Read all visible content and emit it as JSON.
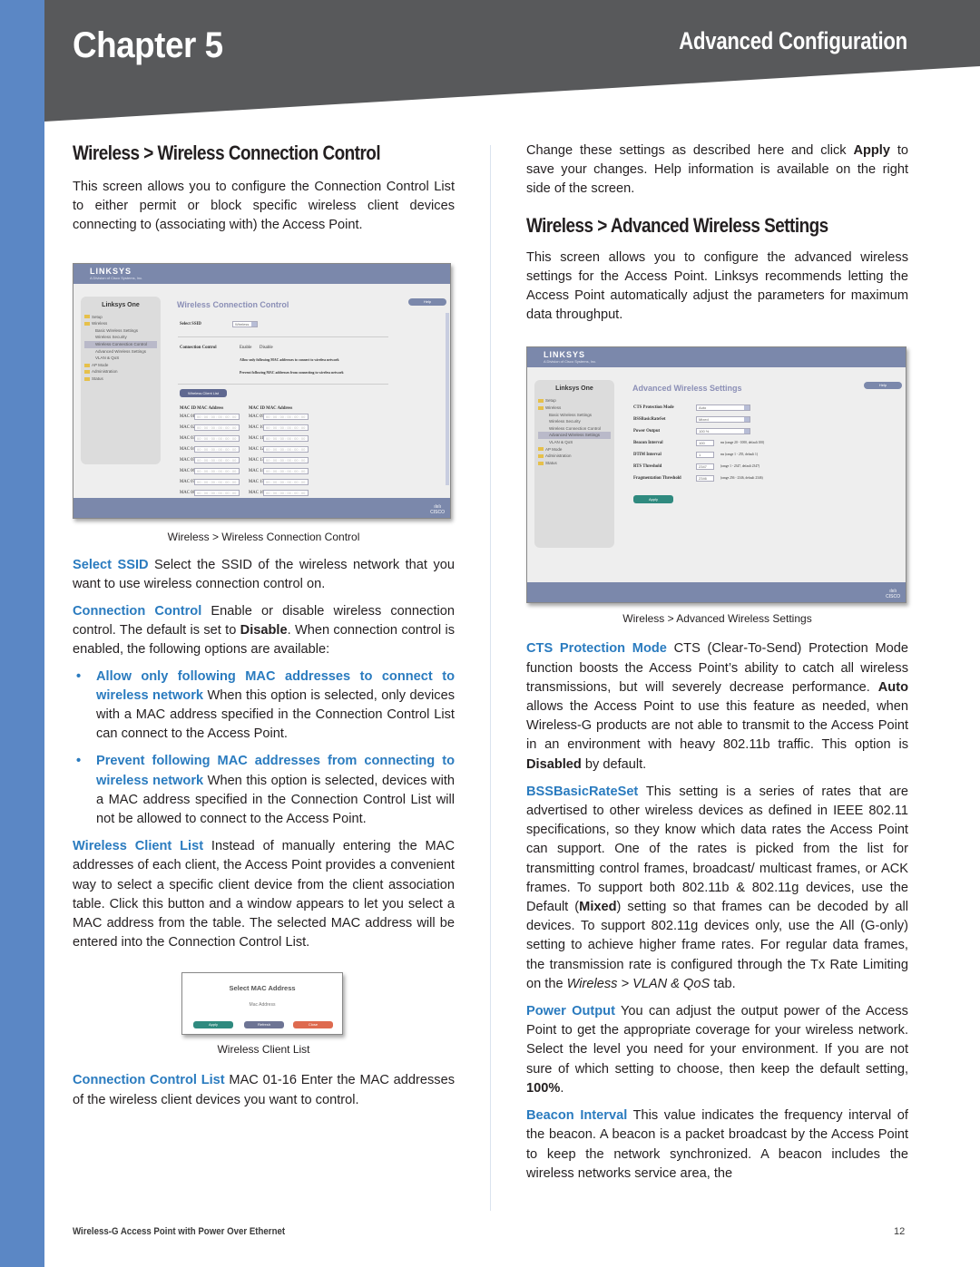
{
  "colors": {
    "side_bar": "#5b87c5",
    "header_band": "#58595b",
    "term_blue": "#2a7bbf",
    "body_text": "#231f20"
  },
  "header": {
    "chapter": "Chapter 5",
    "section": "Advanced Configuration"
  },
  "left": {
    "heading": "Wireless > Wireless Connection Control",
    "intro": "This screen allows you to configure the Connection Control List to either permit or block specific wireless client devices connecting to (associating with) the Access Point.",
    "figure1": {
      "caption": "Wireless > Wireless Connection Control",
      "screen": {
        "logo": "LINKSYS",
        "logo_sub": "A Division of Cisco Systems, Inc.",
        "nav_title": "Linksys One",
        "nav_items": [
          "Setup",
          "Wireless",
          "Basic Wireless Settings",
          "Wireless Security",
          "Wireless Connection Control",
          "Advanced Wireless Settings",
          "VLAN & QoS",
          "AP Mode",
          "Administration",
          "Status"
        ],
        "page_title": "Wireless Connection Control",
        "help": "Help",
        "select_ssid_label": "Select SSID",
        "select_ssid_value": "Wireless",
        "connection_control_label": "Connection Control",
        "enable": "Enable",
        "disable": "Disable",
        "option_allow": "Allow only following MAC addresses to connect to wireless network",
        "option_prevent": "Prevent following MAC addresses from connecting to wireless network",
        "client_list_button": "Wireless Client List",
        "col_header_1": "MAC ID  MAC Address",
        "col_header_2": "MAC ID  MAC Address",
        "mac_ids_1": [
          "MAC 01",
          "MAC 02",
          "MAC 03",
          "MAC 04",
          "MAC 05",
          "MAC 06",
          "MAC 07",
          "MAC 08"
        ],
        "mac_ids_2": [
          "MAC 09",
          "MAC 10",
          "MAC 11",
          "MAC 12",
          "MAC 13",
          "MAC 14",
          "MAC 15",
          "MAC 16"
        ],
        "mac_placeholder": "00 : 00 : 00 : 00 : 00 : 00",
        "cisco": "CISCO"
      }
    },
    "select_ssid": {
      "term": "Select SSID",
      "text": " Select the SSID of the wireless network that you want to use wireless connection control on."
    },
    "connection_control": {
      "term": "Connection Control",
      "text_a": " Enable or disable wireless connection control. The default is set to ",
      "bold": "Disable",
      "text_b": ". When connection control is enabled, the following options are available:"
    },
    "options": [
      {
        "term": "Allow only following MAC addresses to connect to wireless network",
        "text": " When this option is selected, only devices with a MAC address specified in the Connection Control List can connect to the Access Point."
      },
      {
        "term": "Prevent following MAC addresses from connecting to wireless network",
        "text": " When this option is selected, devices with a MAC address specified in the Connection Control List will not be allowed to connect to the Access Point."
      }
    ],
    "wireless_client_list": {
      "term": "Wireless Client List",
      "text": " Instead of manually entering the MAC addresses of each client, the Access Point provides a convenient way to select a specific client device from the client association table. Click this button and a window appears to let you select a MAC address from the table. The selected MAC address will be entered into the Connection Control List."
    },
    "figure2": {
      "caption": "Wireless Client List",
      "dialog_title": "Select MAC Address",
      "dialog_label": "Mac Address",
      "apply": "Apply",
      "refresh": "Refresh",
      "close": "Close"
    },
    "connection_control_list": {
      "term": "Connection Control List",
      "text": " MAC 01-16 Enter the MAC addresses of the wireless client devices you want to control."
    }
  },
  "right": {
    "intro_a": "Change these settings as described here and click ",
    "intro_bold": "Apply",
    "intro_b": " to save your changes. Help information is available on the right side of the screen.",
    "heading": "Wireless > Advanced Wireless Settings",
    "description": "This screen allows you to configure the advanced wireless settings for the Access Point. Linksys recommends letting the Access Point automatically adjust the parameters for maximum data throughput.",
    "figure": {
      "caption": "Wireless > Advanced Wireless Settings",
      "screen": {
        "logo": "LINKSYS",
        "logo_sub": "A Division of Cisco Systems, Inc.",
        "nav_title": "Linksys One",
        "nav_items": [
          "Setup",
          "Wireless",
          "Basic Wireless Settings",
          "Wireless Security",
          "Wireless Connection Control",
          "Advanced Wireless Settings",
          "VLAN & QoS",
          "AP Mode",
          "Administration",
          "Status"
        ],
        "page_title": "Advanced Wireless Settings",
        "help": "Help",
        "fields": [
          {
            "label": "CTS Protection Mode",
            "value": "Auto",
            "type": "select",
            "hint": ""
          },
          {
            "label": "BSSBasicRateSet",
            "value": "Mixed",
            "type": "select",
            "hint": ""
          },
          {
            "label": "Power Output",
            "value": "100 %",
            "type": "select",
            "hint": ""
          },
          {
            "label": "Beacon Interval",
            "value": "100",
            "type": "text",
            "hint": "ms (range 20 - 1000, default 100)"
          },
          {
            "label": "DTIM Interval",
            "value": "1",
            "type": "text",
            "hint": "ms (range 1 - 255, default 1)"
          },
          {
            "label": "RTS Threshold",
            "value": "2347",
            "type": "text",
            "hint": "(range 1 - 2347, default 2347)"
          },
          {
            "label": "Fragmentation Threshold",
            "value": "2346",
            "type": "text",
            "hint": "(range 256 - 2346, default 2346)"
          }
        ],
        "apply": "Apply",
        "cisco": "CISCO"
      }
    },
    "cts": {
      "term": "CTS Protection Mode",
      "text_a": " CTS (Clear-To-Send) Protection Mode function boosts the Access Point’s ability to catch all wireless transmissions, but will severely decrease performance. ",
      "bold_a": "Auto",
      "text_b": " allows the Access Point to use this feature as needed, when Wireless-G products are not able to transmit to the Access Point in an environment with heavy 802.11b traffic. This option is ",
      "bold_b": "Disabled",
      "text_c": " by default."
    },
    "bss": {
      "term": "BSSBasicRateSet",
      "text_a": " This setting is a series of rates that are advertised to other wireless devices as defined in IEEE 802.11 specifications, so they know which data rates the Access Point can support. One of the rates is picked from the list for transmitting control frames, broadcast/ multicast frames, or ACK frames. To support both 802.11b & 802.11g devices, use the Default (",
      "bold": "Mixed",
      "text_b": ") setting so that frames can be decoded by all devices. To support 802.11g devices only, use the All (G-only) setting to achieve higher frame rates. For regular data frames, the transmission rate is configured through the Tx Rate Limiting on the ",
      "italic": "Wireless > VLAN & QoS",
      "text_c": " tab."
    },
    "power": {
      "term": "Power Output",
      "text": " You can adjust the output power of the Access Point to get the appropriate coverage for your wireless network. Select the level you need for your environment. If you are not sure of which setting to choose, then keep the default setting, ",
      "bold": "100%",
      "end": "."
    },
    "beacon": {
      "term": "Beacon Interval",
      "text": " This value indicates the frequency interval of the beacon. A beacon is a packet broadcast by the Access Point to keep the network synchronized. A beacon includes the wireless networks service area, the"
    }
  },
  "footer": {
    "product": "Wireless-G Access Point with  Power Over Ethernet",
    "page": "12"
  }
}
